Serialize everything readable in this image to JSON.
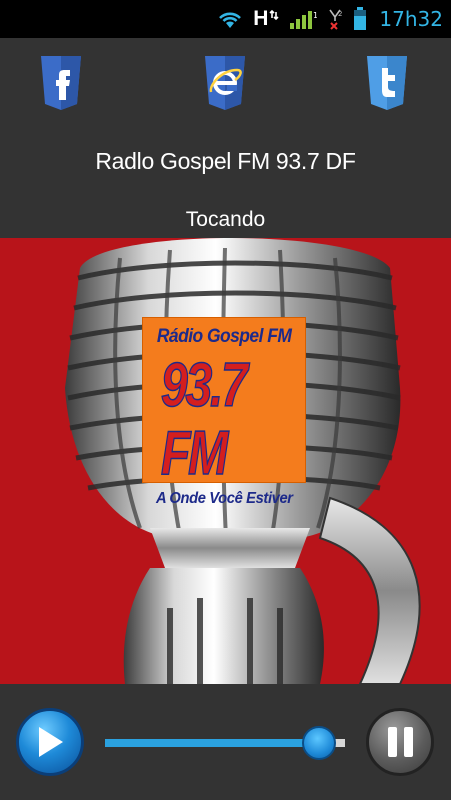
{
  "status_bar": {
    "icons": [
      "wifi-icon",
      "h-network-icon",
      "signal-icon",
      "no-signal-icon",
      "battery-icon"
    ],
    "network_letter": "H",
    "time": "17h32",
    "accent_color": "#33b5e5"
  },
  "header": {
    "social": [
      "facebook-icon",
      "internet-explorer-icon",
      "twitter-icon"
    ],
    "station_title": "Radlo Gospel FM 93.7 DF",
    "status": "Tocando"
  },
  "artwork": {
    "background_color": "#b8141a",
    "logo": {
      "line1": "Rádio Gospel FM",
      "frequency": "93.7 FM",
      "tagline": "A Onde Você Estiver"
    }
  },
  "player": {
    "play_icon": "play-icon",
    "pause_icon": "pause-icon",
    "volume_level": 0.89,
    "accent_color": "#2ba2e0"
  }
}
